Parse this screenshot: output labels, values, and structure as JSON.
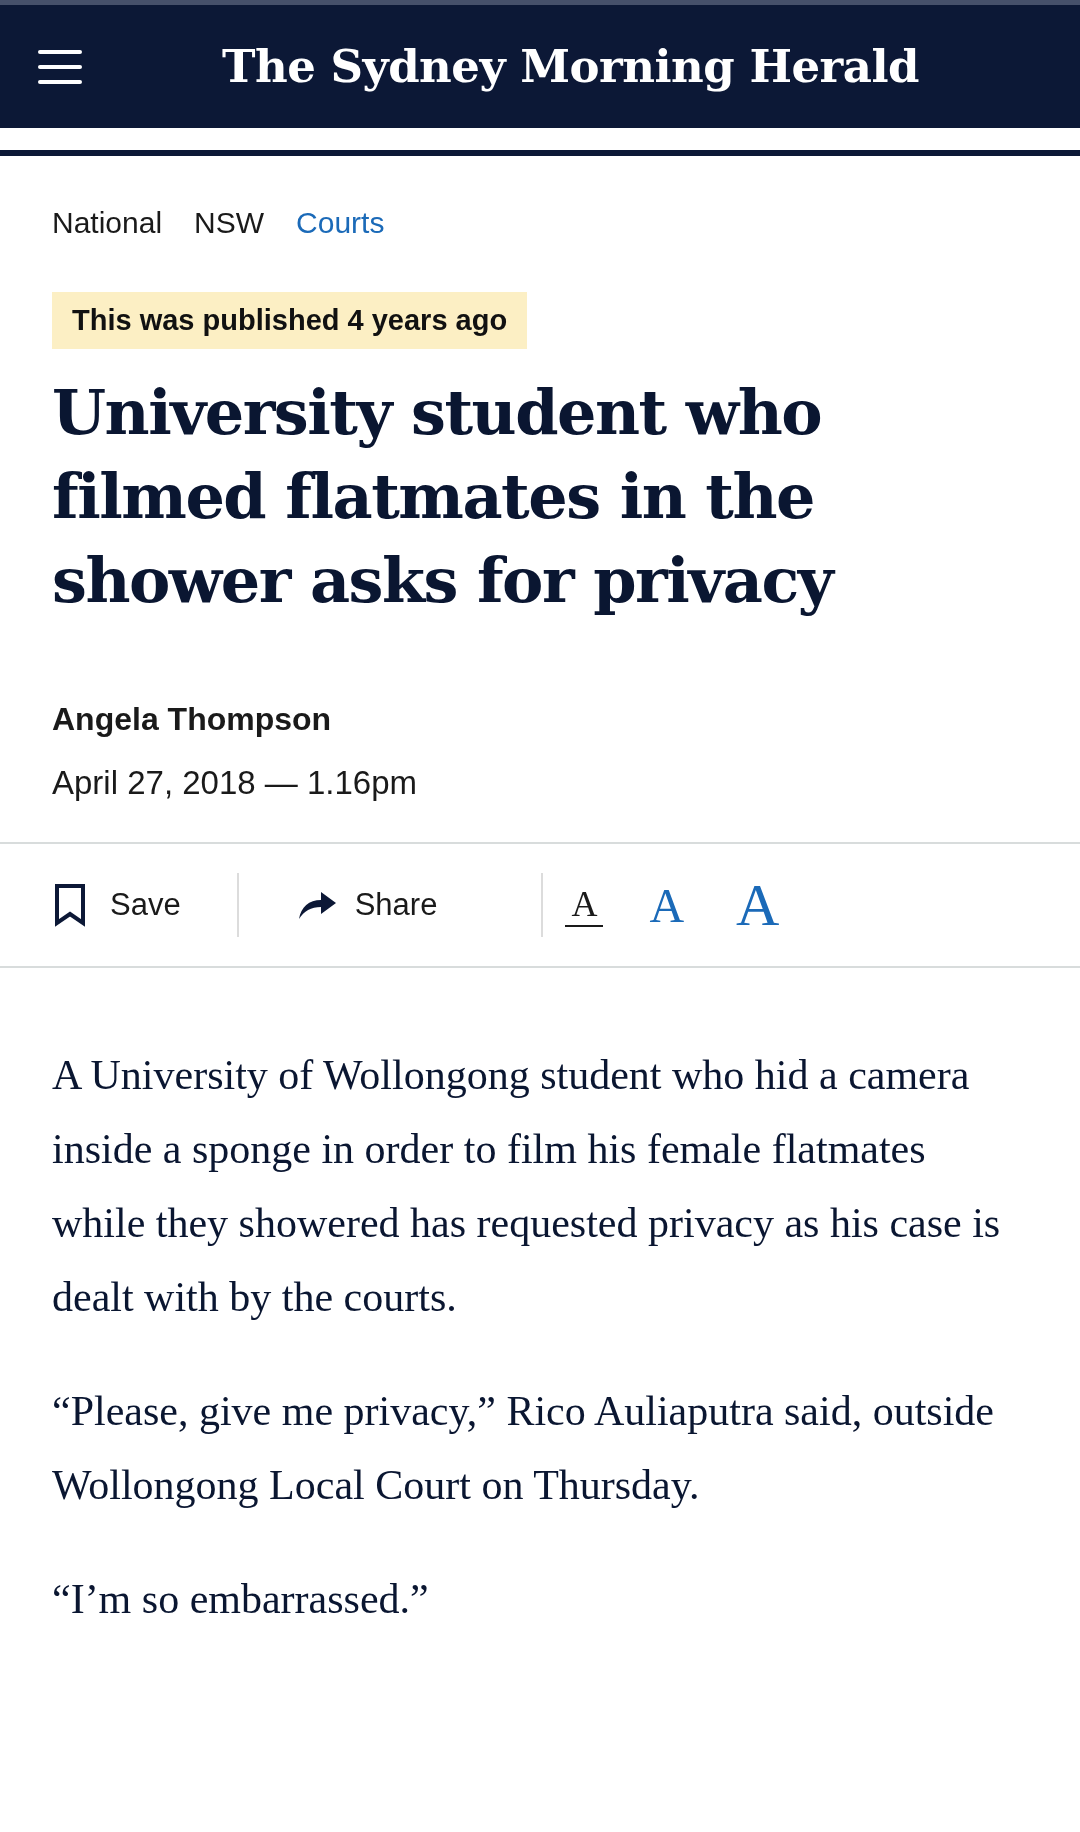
{
  "header": {
    "logo": "The Sydney Morning Herald"
  },
  "breadcrumbs": [
    {
      "label": "National",
      "kind": "plain"
    },
    {
      "label": "NSW",
      "kind": "plain"
    },
    {
      "label": "Courts",
      "kind": "link"
    }
  ],
  "notice": "This was published 4 years ago",
  "headline": "University student who filmed flatmates in the shower asks for privacy",
  "byline": {
    "author": "Angela Thompson",
    "date": "April 27, 2018 — 1.16pm"
  },
  "toolbar": {
    "save": "Save",
    "share": "Share",
    "text_sizes": [
      {
        "label": "A",
        "selected": true
      },
      {
        "label": "A",
        "selected": false
      },
      {
        "label": "A",
        "selected": false
      }
    ]
  },
  "body": [
    "A University of Wollongong student who hid a camera inside a sponge in order to film his female flatmates while they showered has requested privacy as his case is dealt with by the courts.",
    "“Please, give me privacy,” Rico Auliaputra said, outside Wollongong Local Court on Thursday.",
    "“I’m so embarrassed.”"
  ]
}
